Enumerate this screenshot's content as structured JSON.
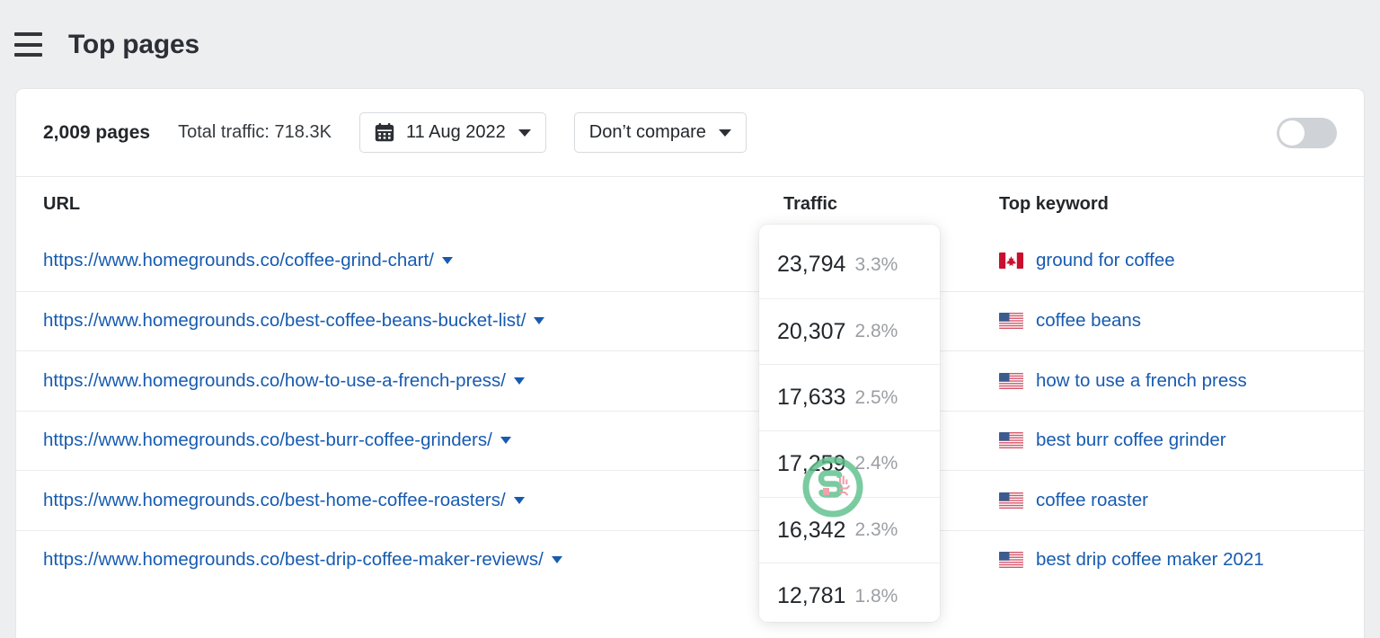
{
  "header": {
    "menu_icon": "hamburger-menu-icon",
    "title": "Top pages"
  },
  "toolbar": {
    "pages_count": "2,009 pages",
    "total_traffic": "Total traffic: 718.3K",
    "date_picker": {
      "icon": "calendar-icon",
      "value": "11 Aug 2022",
      "caret": "chevron-down-icon"
    },
    "compare_dropdown": {
      "value": "Don’t compare",
      "caret": "chevron-down-icon"
    },
    "toggle": {
      "name": "view-toggle",
      "state": "off"
    }
  },
  "table": {
    "columns": [
      "URL",
      "Traffic",
      "Top keyword"
    ],
    "rows": [
      {
        "url": "https://www.homegrounds.co/coffee-grind-chart/",
        "traffic": "23,794",
        "traffic_pct": "3.3%",
        "flag": "ca",
        "keyword": "ground for coffee"
      },
      {
        "url": "https://www.homegrounds.co/best-coffee-beans-bucket-list/",
        "traffic": "20,307",
        "traffic_pct": "2.8%",
        "flag": "us",
        "keyword": "coffee beans"
      },
      {
        "url": "https://www.homegrounds.co/how-to-use-a-french-press/",
        "traffic": "17,633",
        "traffic_pct": "2.5%",
        "flag": "us",
        "keyword": "how to use a french press"
      },
      {
        "url": "https://www.homegrounds.co/best-burr-coffee-grinders/",
        "traffic": "17,259",
        "traffic_pct": "2.4%",
        "flag": "us",
        "keyword": "best burr coffee grinder"
      },
      {
        "url": "https://www.homegrounds.co/best-home-coffee-roasters/",
        "traffic": "16,342",
        "traffic_pct": "2.3%",
        "flag": "us",
        "keyword": "coffee roaster"
      },
      {
        "url": "https://www.homegrounds.co/best-drip-coffee-maker-reviews/",
        "traffic": "12,781",
        "traffic_pct": "1.8%",
        "flag": "us",
        "keyword": "best drip coffee maker 2021"
      }
    ]
  },
  "watermark": {
    "name": "green-s-logo-watermark"
  },
  "colors": {
    "page_background": "#eceef0",
    "card_background": "#ffffff",
    "link_blue": "#175bb0",
    "text_dark": "#23272b",
    "muted_gray": "#9a9ea3",
    "divider": "#ebecee",
    "toggle_track": "#cfd2d6",
    "watermark_green": "#5ec08c"
  }
}
